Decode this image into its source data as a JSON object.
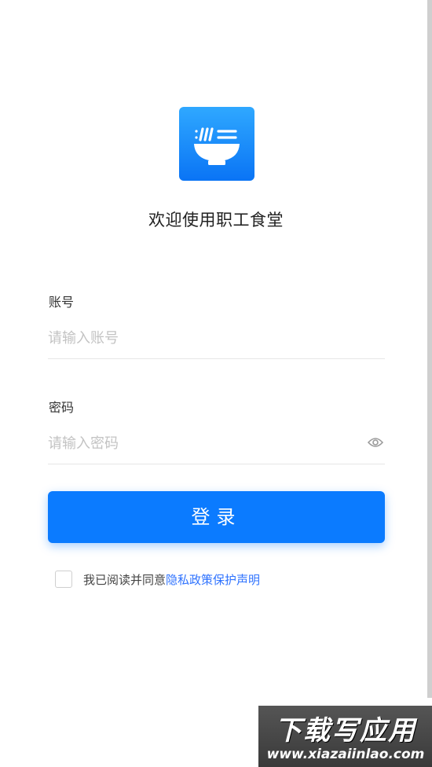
{
  "app": {
    "welcome": "欢迎使用职工食堂"
  },
  "logo": {
    "icon": "bowl-icon",
    "accent_color": "#0b7bff"
  },
  "account": {
    "label": "账号",
    "value": "",
    "placeholder": "请输入账号"
  },
  "password": {
    "label": "密码",
    "value": "",
    "placeholder": "请输入密码",
    "toggle_icon": "eye-icon"
  },
  "login_button": {
    "label": "登录"
  },
  "agreement": {
    "text": "我已阅读并同意",
    "link": "隐私政策保护声明",
    "link_color": "#2f73ff",
    "checked": false
  },
  "watermark": {
    "title": "下载写应用",
    "url": "www.xiazaiinlao.com"
  }
}
